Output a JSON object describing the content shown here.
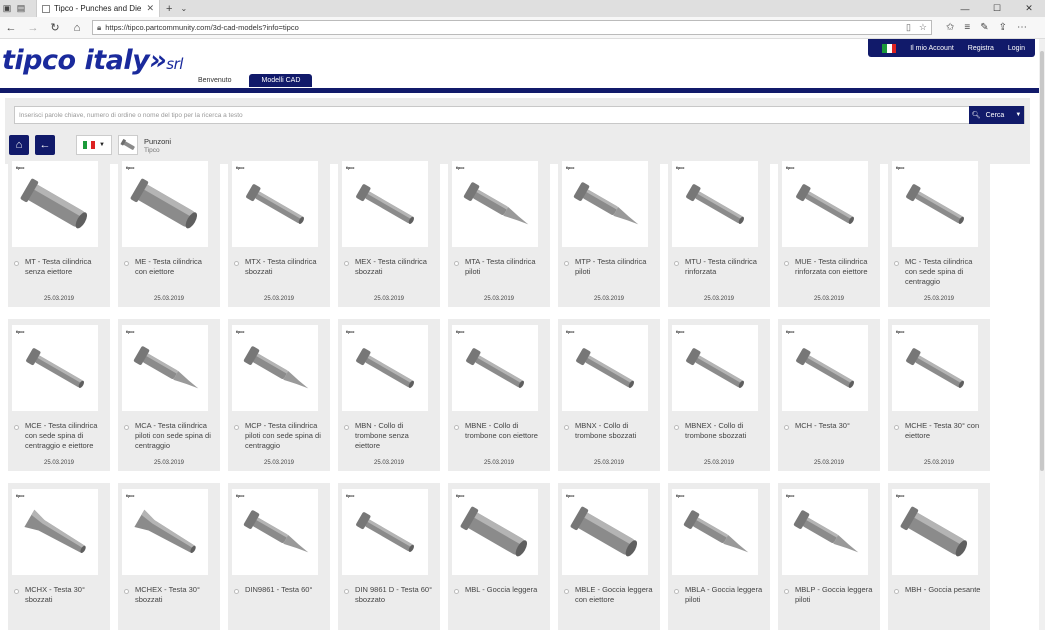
{
  "browser": {
    "tab_title": "Tipco - Punches and Die",
    "url": "https://tipco.partcommunity.com/3d-cad-models?info=tipco"
  },
  "header": {
    "logo_text": "tipco italy",
    "logo_suffix": "srl",
    "account_label": "Il mio Account",
    "register_label": "Registra",
    "login_label": "Login",
    "tabs": [
      {
        "label": "Benvenuto",
        "active": false
      },
      {
        "label": "Modelli CAD",
        "active": true
      }
    ]
  },
  "search": {
    "placeholder": "Inserisci parole chiave, numero di ordine o nome del tipo per la ricerca a testo",
    "button_label": "Cerca"
  },
  "breadcrumb": {
    "title": "Punzoni",
    "subtitle": "Tipco"
  },
  "colors": {
    "brand_navy": "#111a6a",
    "logo_blue": "#1a2a9c"
  },
  "products": [
    {
      "name": "MT - Testa cilindrica senza eiettore",
      "date": "25.03.2019",
      "shape": "fat"
    },
    {
      "name": "ME - Testa cilindrica con eiettore",
      "date": "25.03.2019",
      "shape": "fat"
    },
    {
      "name": "MTX - Testa cilindrica sbozzati",
      "date": "25.03.2019",
      "shape": "thin"
    },
    {
      "name": "MEX - Testa cilindrica sbozzati",
      "date": "25.03.2019",
      "shape": "thin"
    },
    {
      "name": "MTA - Testa cilindrica piloti",
      "date": "25.03.2019",
      "shape": "pilot"
    },
    {
      "name": "MTP - Testa cilindrica piloti",
      "date": "25.03.2019",
      "shape": "pilot"
    },
    {
      "name": "MTU - Testa cilindrica rinforzata",
      "date": "25.03.2019",
      "shape": "thin"
    },
    {
      "name": "MUE - Testa cilindrica rinforzata con eiettore",
      "date": "25.03.2019",
      "shape": "thin"
    },
    {
      "name": "MC - Testa cilindrica con sede spina di centraggio",
      "date": "25.03.2019",
      "shape": "thin"
    },
    {
      "name": "MCE - Testa cilindrica con sede spina di centraggio e eiettore",
      "date": "25.03.2019",
      "shape": "thin"
    },
    {
      "name": "MCA - Testa cilindrica piloti con sede spina di centraggio",
      "date": "25.03.2019",
      "shape": "pilot"
    },
    {
      "name": "MCP - Testa cilindrica piloti con sede spina di centraggio",
      "date": "25.03.2019",
      "shape": "pilot"
    },
    {
      "name": "MBN - Collo di trombone senza eiettore",
      "date": "25.03.2019",
      "shape": "thin"
    },
    {
      "name": "MBNE - Collo di trombone con eiettore",
      "date": "25.03.2019",
      "shape": "thin"
    },
    {
      "name": "MBNX - Collo di trombone sbozzati",
      "date": "25.03.2019",
      "shape": "thin"
    },
    {
      "name": "MBNEX - Collo di trombone sbozzati",
      "date": "25.03.2019",
      "shape": "thin"
    },
    {
      "name": "MCH - Testa 30°",
      "date": "25.03.2019",
      "shape": "thin"
    },
    {
      "name": "MCHE - Testa 30° con eiettore",
      "date": "25.03.2019",
      "shape": "thin"
    },
    {
      "name": "MCHX - Testa 30° sbozzati",
      "date": "",
      "shape": "taper"
    },
    {
      "name": "MCHEX - Testa 30° sbozzati",
      "date": "",
      "shape": "taper"
    },
    {
      "name": "DIN9861 - Testa 60°",
      "date": "",
      "shape": "pilot"
    },
    {
      "name": "DIN 9861 D - Testa 60° sbozzato",
      "date": "",
      "shape": "thin"
    },
    {
      "name": "MBL - Goccia leggera",
      "date": "",
      "shape": "fat"
    },
    {
      "name": "MBLE - Goccia leggera con eiettore",
      "date": "",
      "shape": "fat"
    },
    {
      "name": "MBLA - Goccia leggera piloti",
      "date": "",
      "shape": "pilot"
    },
    {
      "name": "MBLP - Goccia leggera piloti",
      "date": "",
      "shape": "pilot"
    },
    {
      "name": "MBH - Goccia pesante",
      "date": "",
      "shape": "fat"
    }
  ],
  "badge_text": "tipco"
}
